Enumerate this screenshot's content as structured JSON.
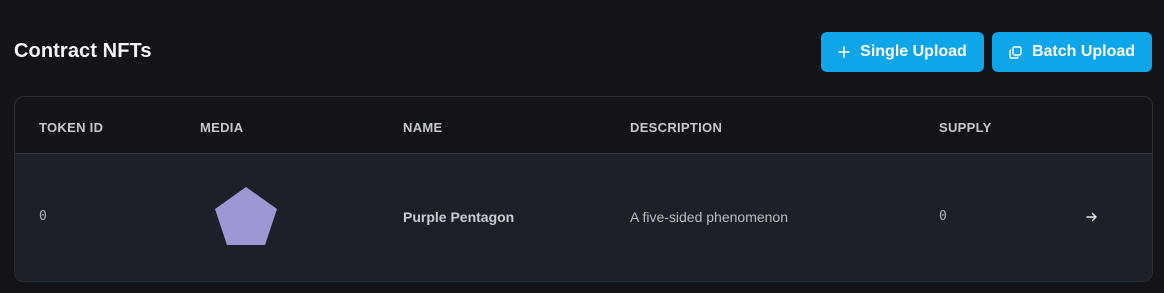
{
  "header": {
    "title": "Contract NFTs",
    "single_upload_label": "Single Upload",
    "batch_upload_label": "Batch Upload"
  },
  "table": {
    "columns": [
      "TOKEN ID",
      "MEDIA",
      "NAME",
      "DESCRIPTION",
      "SUPPLY"
    ],
    "rows": [
      {
        "token_id": "0",
        "media_color": "#9b98d4",
        "name": "Purple Pentagon",
        "description": "A five-sided phenomenon",
        "supply": "0"
      }
    ]
  },
  "colors": {
    "accent": "#0ea5e9",
    "background": "#12141a",
    "row_background": "#1c2028"
  },
  "icons": {
    "single_upload": "plus-icon",
    "batch_upload": "copy-icon",
    "row_action": "arrow-right-icon"
  }
}
